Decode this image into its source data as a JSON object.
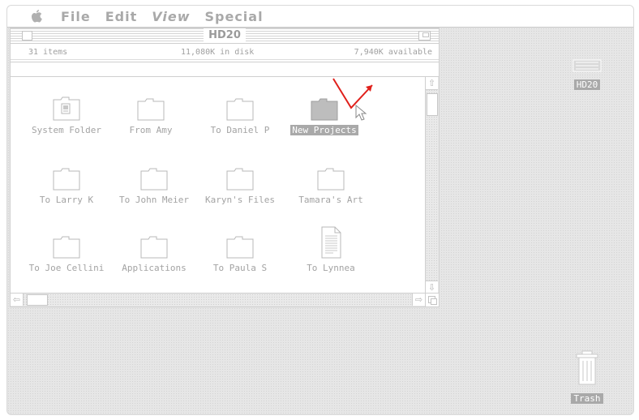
{
  "menubar": {
    "items": [
      "File",
      "Edit",
      "View",
      "Special"
    ]
  },
  "window": {
    "title": "HD20",
    "info": {
      "items": "31 items",
      "in_disk": "11,080K in disk",
      "available": "7,940K available"
    },
    "icons": [
      {
        "label": "System Folder",
        "icon": "system-folder-icon"
      },
      {
        "label": "From Amy",
        "icon": "folder-icon"
      },
      {
        "label": "To Daniel P",
        "icon": "folder-icon"
      },
      {
        "label": "New Projects",
        "icon": "folder-icon",
        "selected": true
      },
      {
        "label": "To Larry K",
        "icon": "folder-icon"
      },
      {
        "label": "To John Meier",
        "icon": "folder-icon"
      },
      {
        "label": "Karyn's Files",
        "icon": "folder-icon"
      },
      {
        "label": "Tamara's Art",
        "icon": "folder-icon"
      },
      {
        "label": "To Joe Cellini",
        "icon": "folder-icon"
      },
      {
        "label": "Applications",
        "icon": "folder-icon"
      },
      {
        "label": "To Paula S",
        "icon": "folder-icon"
      },
      {
        "label": "To Lynnea",
        "icon": "document-icon"
      }
    ]
  },
  "desktop": {
    "disk": {
      "label": "HD20",
      "icon": "hard-disk-icon"
    },
    "trash": {
      "label": "Trash",
      "icon": "trash-icon"
    }
  },
  "colors": {
    "annotation": "#e0201b",
    "selection": "#a9a9a9"
  }
}
